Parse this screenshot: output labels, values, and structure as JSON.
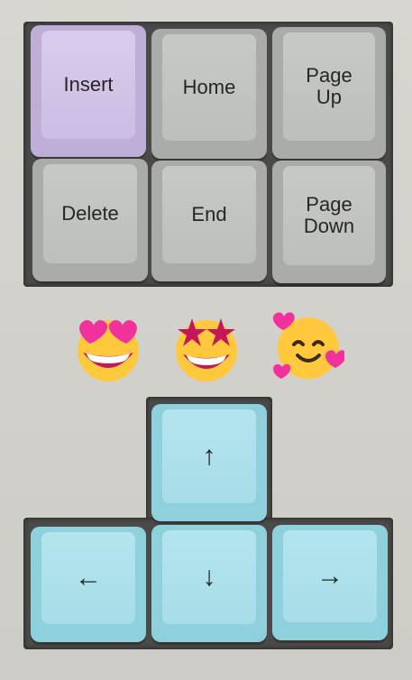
{
  "keys": {
    "insert": "Insert",
    "home": "Home",
    "page_up": "Page\nUp",
    "delete": "Delete",
    "end": "End",
    "page_down": "Page\nDown"
  },
  "arrow_glyphs": {
    "up": "↑",
    "down": "↓",
    "left": "←",
    "right": "→"
  },
  "emojis": [
    "heart-eyes",
    "star-struck",
    "smiling-with-hearts"
  ],
  "colors": {
    "purple_key": "#cbbde3",
    "gray_key": "#bdbfbc",
    "blue_key": "#a6dde8",
    "emoji_face": "#ffc83d",
    "heart": "#f2329c"
  }
}
